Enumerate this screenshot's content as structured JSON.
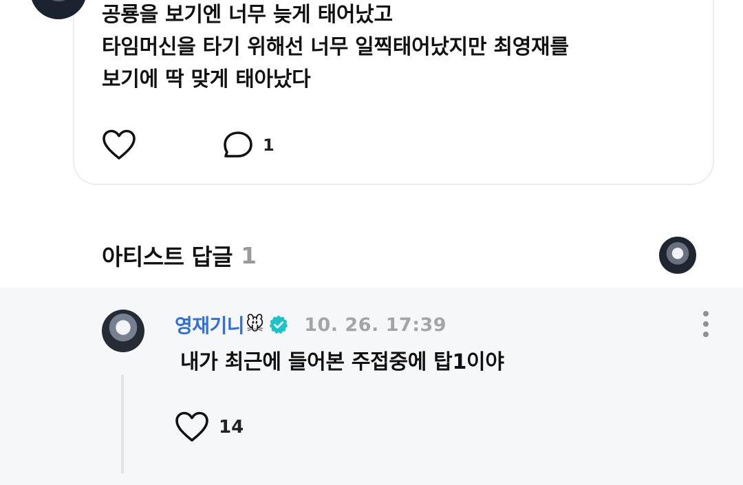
{
  "post": {
    "lines": [
      "공룡을 보기엔 너무 늦게 태어났고",
      "타임머신을 타기 위해선 너무 일찍태어났지만 최영재를",
      "보기에 딱 맞게 태아났다"
    ],
    "comment_count": "1",
    "icons": {
      "like": "heart-outline-icon",
      "comment": "comment-bubble-icon"
    }
  },
  "artist_section": {
    "title": "아티스트 답글",
    "count": "1"
  },
  "reply": {
    "author": "영재기니",
    "emoji": "🐭",
    "verified_icon": "verified-badge-icon",
    "timestamp": "10. 26. 17:39",
    "text": "내가 최근에 들어본 주접중에 탑1이야",
    "like_count": "14"
  },
  "colors": {
    "author_blue": "#2f6fe0",
    "verified_teal": "#18c3c9",
    "timestamp_gray": "#a3a5a8",
    "reply_bg": "#f6f7f8"
  }
}
